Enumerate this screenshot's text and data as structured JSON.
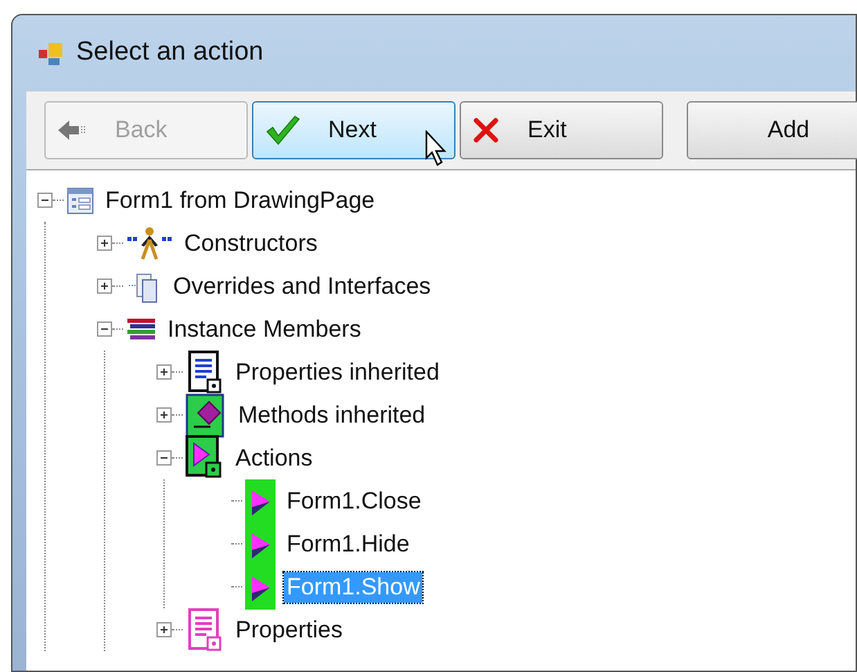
{
  "window": {
    "title": "Select an action"
  },
  "toolbar": [
    {
      "label": "Back",
      "kind": "back",
      "disabled": true,
      "highlighted": false
    },
    {
      "label": "Next",
      "kind": "next",
      "disabled": false,
      "highlighted": true
    },
    {
      "label": "Exit",
      "kind": "exit",
      "disabled": false,
      "highlighted": false
    },
    {
      "label": "Add",
      "kind": "add",
      "disabled": false,
      "highlighted": false
    }
  ],
  "tree": [
    {
      "label": "Form1 from DrawingPage",
      "kind": "form",
      "expanded": true,
      "selected": false,
      "children": [
        {
          "label": "Constructors",
          "kind": "constructors",
          "expanded": false,
          "selected": false
        },
        {
          "label": "Overrides and Interfaces",
          "kind": "overrides",
          "expanded": false,
          "selected": false
        },
        {
          "label": "Instance Members",
          "kind": "members",
          "expanded": true,
          "selected": false,
          "children": [
            {
              "label": "Properties inherited",
              "kind": "properties-inherited",
              "expanded": false,
              "selected": false
            },
            {
              "label": "Methods inherited",
              "kind": "methods",
              "expanded": false,
              "selected": false
            },
            {
              "label": "Actions",
              "kind": "actions",
              "expanded": true,
              "selected": false,
              "children": [
                {
                  "label": "Form1.Close",
                  "kind": "action",
                  "selected": false
                },
                {
                  "label": "Form1.Hide",
                  "kind": "action",
                  "selected": false
                },
                {
                  "label": "Form1.Show",
                  "kind": "action",
                  "selected": true
                }
              ]
            },
            {
              "label": "Properties",
              "kind": "properties",
              "expanded": false,
              "selected": false
            }
          ]
        }
      ]
    }
  ]
}
